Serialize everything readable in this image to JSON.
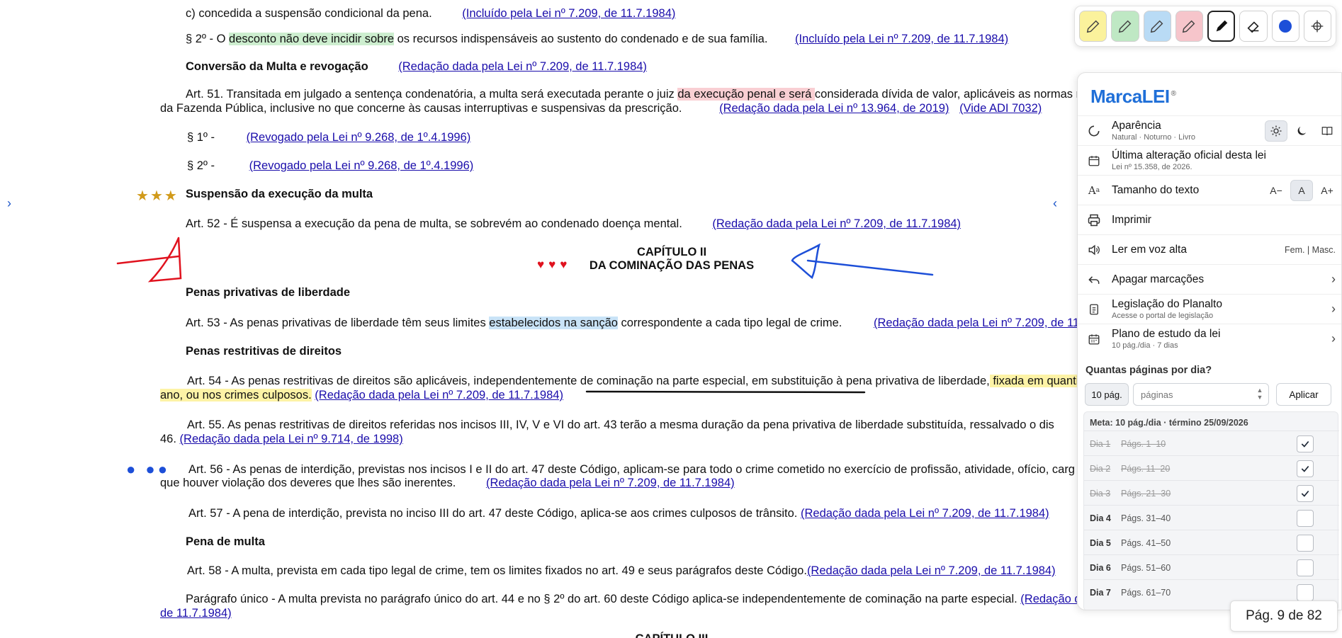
{
  "doc": {
    "l1": {
      "text": "c) concedida a suspensão condicional da pena.",
      "link": "(Incluído pela Lei nº 7.209, de 11.7.1984)"
    },
    "l2": {
      "pre": "§ 2º - O ",
      "hl": "desconto não deve incidir sobre",
      "post": " os recursos indispensáveis ao sustento do condenado e de sua família.",
      "link": "(Incluído pela Lei nº 7.209, de 11.7.1984)"
    },
    "h_conversao": {
      "text": "Conversão da Multa e revogação",
      "link": "(Redação dada pela Lei nº 7.209, de 11.7.1984)"
    },
    "art51": {
      "pre": "Art. 51. Transitada em julgado a sentença condenatória, a multa será executada perante o juiz ",
      "hl": "da execução penal e será ",
      "post": "considerada dívida de valor, aplicáveis as normas rel",
      "line2": "da Fazenda Pública, inclusive no que concerne às causas interruptivas e suspensivas da prescrição.",
      "link1": "(Redação dada pela Lei nº 13.964, de 2019)",
      "link2": "(Vide ADI 7032)"
    },
    "p1": {
      "text": "§ 1º -",
      "link": "(Revogado pela Lei nº 9.268, de 1º.4.1996)"
    },
    "p2": {
      "text": "§ 2º -",
      "link": "(Revogado pela Lei nº 9.268, de 1º.4.1996)"
    },
    "h_suspensao": "Suspensão da execução da multa",
    "art52": {
      "text": "Art. 52 - É suspensa a execução da pena de multa, se sobrevém ao condenado doença mental.",
      "link": "(Redação dada pela Lei nº 7.209, de 11.7.1984)"
    },
    "cap2_a": "CAPÍTULO II",
    "cap2_b": "DA COMINAÇÃO DAS PENAS",
    "h_privativas": "Penas privativas de liberdade",
    "art53": {
      "pre": "Art. 53 - As penas privativas de liberdade têm seus limites ",
      "hl": "estabelecidos na sanção",
      "post": " correspondente a cada tipo legal de crime.",
      "link": "(Redação dada pela Lei nº 7.209, de 11.7"
    },
    "h_restritivas": "Penas restritivas de direitos",
    "art54": {
      "pre": "Art. 54 - As penas restritivas de direitos são aplicáveis, independentemente de cominação na parte especial, em substituição à pena privativa de liberdade,",
      "hl": " fixada em quantid",
      "hl2": "ano, ou nos crimes culposos.",
      "link": "(Redação dada pela Lei nº 7.209, de 11.7.1984)"
    },
    "art55": {
      "text": "Art. 55. As penas restritivas de direitos referidas nos incisos III, IV, V e VI do art. 43 terão a mesma duração da pena privativa de liberdade substituída, ressalvado o dis",
      "line2": "46.",
      "link": "(Redação dada pela Lei nº 9.714, de 1998)"
    },
    "art56": {
      "text": "Art. 56 - As penas de interdição, previstas nos incisos I e II do art. 47 deste Código, aplicam-se para todo o crime cometido no exercício de profissão, atividade, ofício, carg",
      "line2": "que houver violação dos deveres que lhes são inerentes.",
      "link": "(Redação dada pela Lei nº 7.209, de 11.7.1984)"
    },
    "art57": {
      "text": "Art. 57 - A pena de interdição, prevista no inciso III do art. 47 deste Código, aplica-se aos crimes culposos de trânsito.",
      "link": "(Redação dada pela Lei nº 7.209, de 11.7.1984)"
    },
    "h_multa": "Pena de multa",
    "art58": {
      "text": "Art. 58 - A multa, prevista em cada tipo legal de crime, tem os limites fixados no art. 49 e seus parágrafos deste Código.",
      "link": "(Redação dada pela Lei nº 7.209, de 11.7.1984)"
    },
    "unico": {
      "text": "Parágrafo único - A multa prevista no parágrafo único do art. 44 e no § 2º do art. 60 deste Código aplica-se independentemente de cominação na parte especial.",
      "link": "(Redação da",
      "line2link": "de 11.7.1984)"
    },
    "cap3": "CAPÍTULO III",
    "left_chevron": "›",
    "right_chevron": "‹"
  },
  "toolbar": {
    "tools": [
      "yellow-highlighter",
      "green-highlighter",
      "blue-highlighter",
      "red-highlighter",
      "pen",
      "eraser",
      "color-dot",
      "crosshair"
    ],
    "colors": {
      "yellow": "#fbf29c",
      "green": "#bfe8c4",
      "blue": "#b9dbf5",
      "red": "#f6c5cb",
      "dot": "#1d4fd8"
    }
  },
  "panel": {
    "brand": "MarcaLEI",
    "brand_mark": "®",
    "aparencia": {
      "title": "Aparência",
      "sub": "Natural · Noturno · Livro"
    },
    "alteracao": {
      "title": "Última alteração oficial desta lei",
      "sub": "Lei nº 15.358, de 2026."
    },
    "tamanho": {
      "title": "Tamanho do texto",
      "minus": "A−",
      "normal": "A",
      "plus": "A+"
    },
    "imprimir": "Imprimir",
    "ler": {
      "title": "Ler em voz alta",
      "opts": "Fem. | Masc."
    },
    "apagar": "Apagar marcações",
    "planalto": {
      "title": "Legislação do Planalto",
      "sub": "Acesse o portal de legislação"
    },
    "plano": {
      "title": "Plano de estudo da lei",
      "sub": "10 pág./dia · 7 dias"
    },
    "question": "Quantas páginas por dia?",
    "btn_10": "10 pág.",
    "input_placeholder": "páginas",
    "apply": "Aplicar",
    "meta": "Meta: 10 pág./dia · término 25/09/2026",
    "days": [
      {
        "day": "Dia 1",
        "pages": "Págs. 1–10",
        "done": true
      },
      {
        "day": "Dia 2",
        "pages": "Págs. 11–20",
        "done": true
      },
      {
        "day": "Dia 3",
        "pages": "Págs. 21–30",
        "done": true
      },
      {
        "day": "Dia 4",
        "pages": "Págs. 31–40",
        "done": false
      },
      {
        "day": "Dia 5",
        "pages": "Págs. 41–50",
        "done": false
      },
      {
        "day": "Dia 6",
        "pages": "Págs. 51–60",
        "done": false
      },
      {
        "day": "Dia 7",
        "pages": "Págs. 61–70",
        "done": false
      }
    ]
  },
  "page_indicator": "Pág. 9 de 82"
}
